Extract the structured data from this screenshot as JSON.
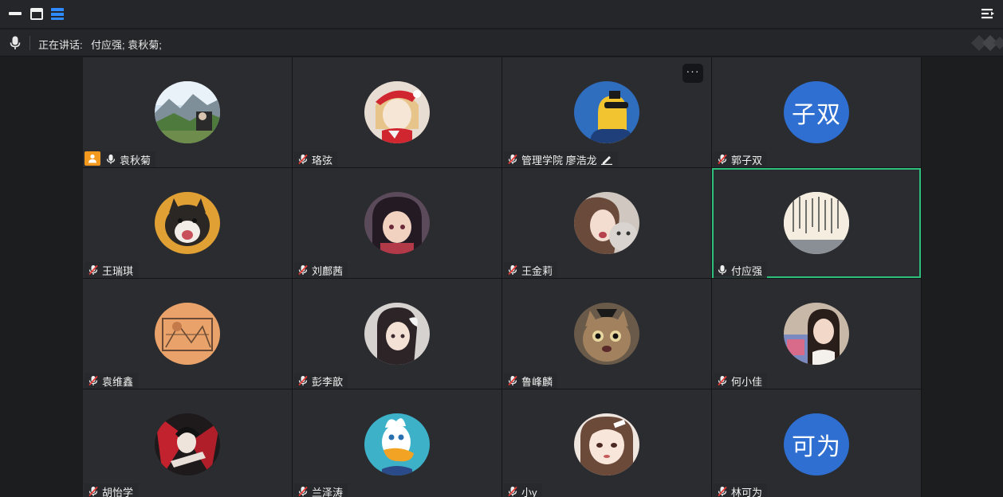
{
  "speaking": {
    "label": "正在讲话:",
    "names": "付应强; 袁秋菊;"
  },
  "colors": {
    "active_border": "#2fbf7c",
    "host_badge": "#f39a1e",
    "text_avatar": "#2e6fd1",
    "layout_icon": "#2f8cff"
  },
  "participants": [
    {
      "name": "袁秋菊",
      "mic": "on",
      "host": true,
      "avatar": "landscape-photo"
    },
    {
      "name": "珞弦",
      "mic": "off",
      "avatar": "anime-santa-hat"
    },
    {
      "name": "管理学院 廖浩龙",
      "mic": "off",
      "avatar": "cartoon-sunglasses",
      "more": "···",
      "editing": true
    },
    {
      "name": "郭子双",
      "mic": "off",
      "avatar_text": "子双"
    },
    {
      "name": "王瑞琪",
      "mic": "off",
      "avatar": "dog-photo"
    },
    {
      "name": "刘鄜茜",
      "mic": "off",
      "avatar": "anime-girl"
    },
    {
      "name": "王金莉",
      "mic": "off",
      "avatar": "girl-with-cat"
    },
    {
      "name": "付应强",
      "mic": "on",
      "active": true,
      "avatar": "calligraphy"
    },
    {
      "name": "袁维鑫",
      "mic": "off",
      "avatar": "sketch-drawing"
    },
    {
      "name": "彭李歆",
      "mic": "off",
      "avatar": "anime-girl-2"
    },
    {
      "name": "鲁峰麟",
      "mic": "off",
      "avatar": "cat-photo"
    },
    {
      "name": "何小佳",
      "mic": "off",
      "avatar": "girl-photo"
    },
    {
      "name": "胡怡学",
      "mic": "off",
      "avatar": "red-anime-art"
    },
    {
      "name": "兰泽涛",
      "mic": "off",
      "avatar": "donald-duck"
    },
    {
      "name": "小y",
      "mic": "off",
      "avatar": "drawn-girl"
    },
    {
      "name": "林可为",
      "mic": "off",
      "avatar_text": "可为"
    }
  ]
}
